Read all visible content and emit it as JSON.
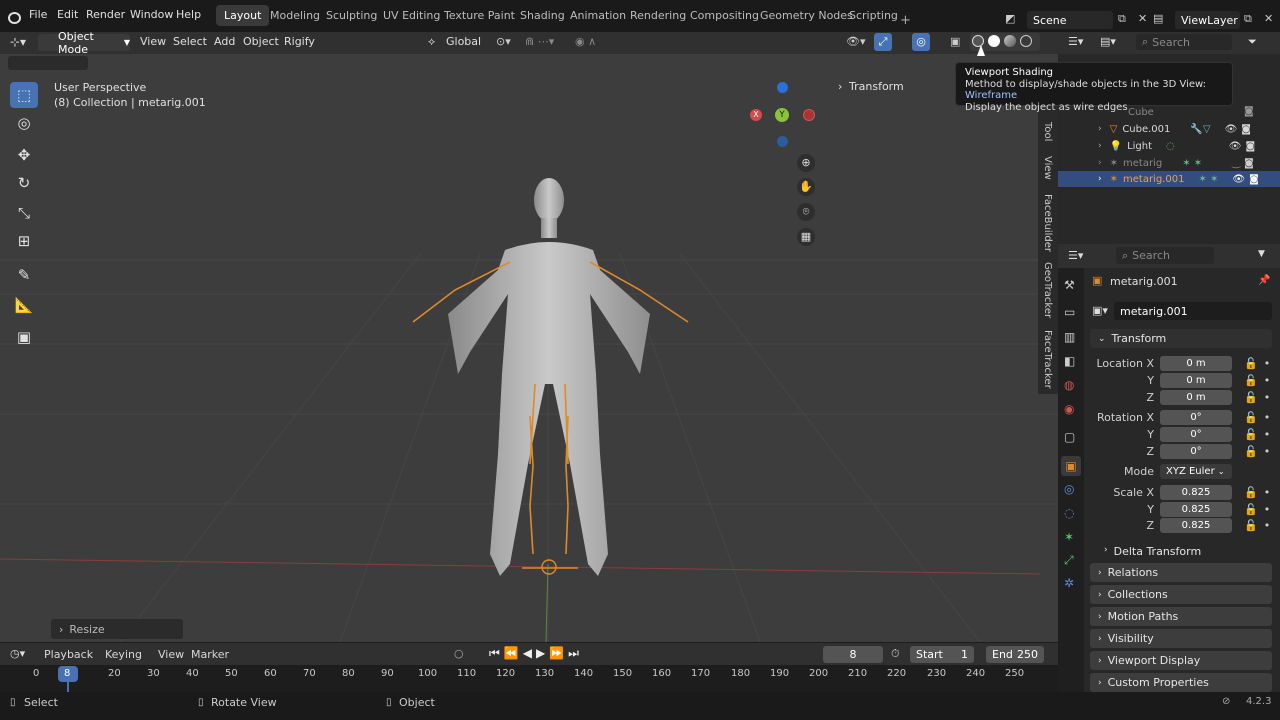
{
  "menus": [
    "File",
    "Edit",
    "Render",
    "Window",
    "Help"
  ],
  "workspaces": [
    "Layout",
    "Modeling",
    "Sculpting",
    "UV Editing",
    "Texture Paint",
    "Shading",
    "Animation",
    "Rendering",
    "Compositing",
    "Geometry Nodes",
    "Scripting"
  ],
  "scene": "Scene",
  "view_layer": "ViewLayer",
  "header": {
    "mode": "Object Mode",
    "menus": [
      "View",
      "Select",
      "Add",
      "Object",
      "Rigify"
    ],
    "orientation": "Global"
  },
  "viewport": {
    "perspective": "User Perspective",
    "collection": "(8) Collection | metarig.001",
    "transform_tab": "Transform",
    "side_tabs": [
      "Tool",
      "View",
      "FaceBuilder",
      "GeoTracker",
      "FaceTracker"
    ],
    "resize_panel": "Resize",
    "axes": {
      "x": "X",
      "y": "Y"
    }
  },
  "tooltip": {
    "title": "Viewport Shading",
    "line1": "Method to display/shade objects in the 3D View: ",
    "line1_value": "Wireframe",
    "line2": "Display the object as wire edges"
  },
  "outliner": {
    "items": [
      "Cube",
      "Cube.001",
      "Light",
      "metarig",
      "metarig.001"
    ]
  },
  "properties": {
    "search_placeholder": "Search",
    "object_name": "metarig.001",
    "data_name": "metarig.001",
    "transform_label": "Transform",
    "location_x_label": "Location X",
    "location_x": "0 m",
    "y_label": "Y",
    "z_label": "Z",
    "location_y": "0 m",
    "location_z": "0 m",
    "rotation_x_label": "Rotation X",
    "rotation_x": "0°",
    "rotation_y": "0°",
    "rotation_z": "0°",
    "mode_label": "Mode",
    "mode_value": "XYZ Euler",
    "scale_x_label": "Scale X",
    "scale_x": "0.825",
    "scale_y": "0.825",
    "scale_z": "0.825",
    "panels": [
      "Delta Transform",
      "Relations",
      "Collections",
      "Motion Paths",
      "Visibility",
      "Viewport Display",
      "Custom Properties"
    ]
  },
  "outliner_search": "Search",
  "timeline": {
    "menus": [
      "Playback",
      "Keying",
      "View",
      "Marker"
    ],
    "current_frame": "8",
    "start_label": "Start",
    "start": "1",
    "end_label": "End",
    "end": "250",
    "ticks": [
      "0",
      "8",
      "20",
      "30",
      "40",
      "50",
      "60",
      "70",
      "80",
      "90",
      "100",
      "110",
      "120",
      "130",
      "140",
      "150",
      "160",
      "170",
      "180",
      "190",
      "200",
      "210",
      "220",
      "230",
      "240",
      "250"
    ]
  },
  "status": {
    "select": "Select",
    "rotate": "Rotate View",
    "object": "Object",
    "version": "4.2.3"
  },
  "colors": {
    "accent": "#4772b3",
    "bone": "#e0892a",
    "background_viewport": "#3d3d3d"
  }
}
